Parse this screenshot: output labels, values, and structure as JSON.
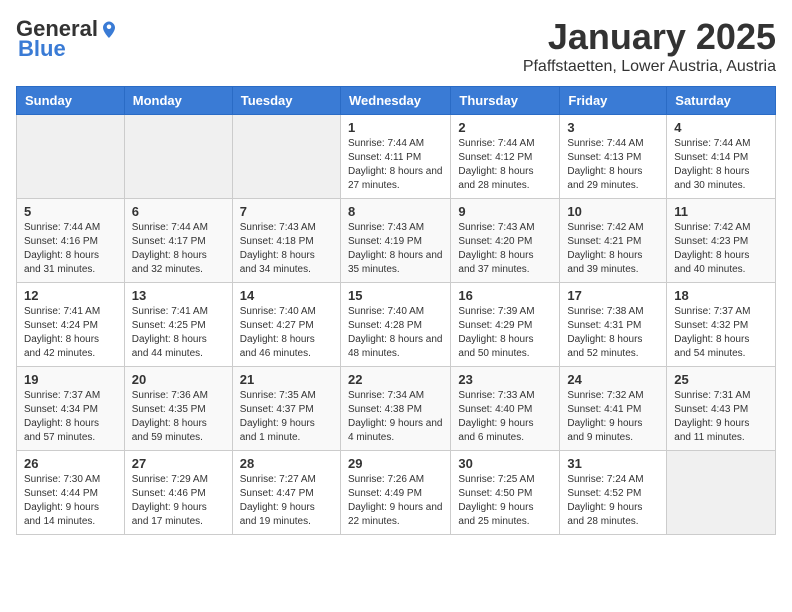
{
  "logo": {
    "general": "General",
    "blue": "Blue"
  },
  "header": {
    "month": "January 2025",
    "location": "Pfaffstaetten, Lower Austria, Austria"
  },
  "weekdays": [
    "Sunday",
    "Monday",
    "Tuesday",
    "Wednesday",
    "Thursday",
    "Friday",
    "Saturday"
  ],
  "weeks": [
    [
      {
        "day": "",
        "info": ""
      },
      {
        "day": "",
        "info": ""
      },
      {
        "day": "",
        "info": ""
      },
      {
        "day": "1",
        "info": "Sunrise: 7:44 AM\nSunset: 4:11 PM\nDaylight: 8 hours and 27 minutes."
      },
      {
        "day": "2",
        "info": "Sunrise: 7:44 AM\nSunset: 4:12 PM\nDaylight: 8 hours and 28 minutes."
      },
      {
        "day": "3",
        "info": "Sunrise: 7:44 AM\nSunset: 4:13 PM\nDaylight: 8 hours and 29 minutes."
      },
      {
        "day": "4",
        "info": "Sunrise: 7:44 AM\nSunset: 4:14 PM\nDaylight: 8 hours and 30 minutes."
      }
    ],
    [
      {
        "day": "5",
        "info": "Sunrise: 7:44 AM\nSunset: 4:16 PM\nDaylight: 8 hours and 31 minutes."
      },
      {
        "day": "6",
        "info": "Sunrise: 7:44 AM\nSunset: 4:17 PM\nDaylight: 8 hours and 32 minutes."
      },
      {
        "day": "7",
        "info": "Sunrise: 7:43 AM\nSunset: 4:18 PM\nDaylight: 8 hours and 34 minutes."
      },
      {
        "day": "8",
        "info": "Sunrise: 7:43 AM\nSunset: 4:19 PM\nDaylight: 8 hours and 35 minutes."
      },
      {
        "day": "9",
        "info": "Sunrise: 7:43 AM\nSunset: 4:20 PM\nDaylight: 8 hours and 37 minutes."
      },
      {
        "day": "10",
        "info": "Sunrise: 7:42 AM\nSunset: 4:21 PM\nDaylight: 8 hours and 39 minutes."
      },
      {
        "day": "11",
        "info": "Sunrise: 7:42 AM\nSunset: 4:23 PM\nDaylight: 8 hours and 40 minutes."
      }
    ],
    [
      {
        "day": "12",
        "info": "Sunrise: 7:41 AM\nSunset: 4:24 PM\nDaylight: 8 hours and 42 minutes."
      },
      {
        "day": "13",
        "info": "Sunrise: 7:41 AM\nSunset: 4:25 PM\nDaylight: 8 hours and 44 minutes."
      },
      {
        "day": "14",
        "info": "Sunrise: 7:40 AM\nSunset: 4:27 PM\nDaylight: 8 hours and 46 minutes."
      },
      {
        "day": "15",
        "info": "Sunrise: 7:40 AM\nSunset: 4:28 PM\nDaylight: 8 hours and 48 minutes."
      },
      {
        "day": "16",
        "info": "Sunrise: 7:39 AM\nSunset: 4:29 PM\nDaylight: 8 hours and 50 minutes."
      },
      {
        "day": "17",
        "info": "Sunrise: 7:38 AM\nSunset: 4:31 PM\nDaylight: 8 hours and 52 minutes."
      },
      {
        "day": "18",
        "info": "Sunrise: 7:37 AM\nSunset: 4:32 PM\nDaylight: 8 hours and 54 minutes."
      }
    ],
    [
      {
        "day": "19",
        "info": "Sunrise: 7:37 AM\nSunset: 4:34 PM\nDaylight: 8 hours and 57 minutes."
      },
      {
        "day": "20",
        "info": "Sunrise: 7:36 AM\nSunset: 4:35 PM\nDaylight: 8 hours and 59 minutes."
      },
      {
        "day": "21",
        "info": "Sunrise: 7:35 AM\nSunset: 4:37 PM\nDaylight: 9 hours and 1 minute."
      },
      {
        "day": "22",
        "info": "Sunrise: 7:34 AM\nSunset: 4:38 PM\nDaylight: 9 hours and 4 minutes."
      },
      {
        "day": "23",
        "info": "Sunrise: 7:33 AM\nSunset: 4:40 PM\nDaylight: 9 hours and 6 minutes."
      },
      {
        "day": "24",
        "info": "Sunrise: 7:32 AM\nSunset: 4:41 PM\nDaylight: 9 hours and 9 minutes."
      },
      {
        "day": "25",
        "info": "Sunrise: 7:31 AM\nSunset: 4:43 PM\nDaylight: 9 hours and 11 minutes."
      }
    ],
    [
      {
        "day": "26",
        "info": "Sunrise: 7:30 AM\nSunset: 4:44 PM\nDaylight: 9 hours and 14 minutes."
      },
      {
        "day": "27",
        "info": "Sunrise: 7:29 AM\nSunset: 4:46 PM\nDaylight: 9 hours and 17 minutes."
      },
      {
        "day": "28",
        "info": "Sunrise: 7:27 AM\nSunset: 4:47 PM\nDaylight: 9 hours and 19 minutes."
      },
      {
        "day": "29",
        "info": "Sunrise: 7:26 AM\nSunset: 4:49 PM\nDaylight: 9 hours and 22 minutes."
      },
      {
        "day": "30",
        "info": "Sunrise: 7:25 AM\nSunset: 4:50 PM\nDaylight: 9 hours and 25 minutes."
      },
      {
        "day": "31",
        "info": "Sunrise: 7:24 AM\nSunset: 4:52 PM\nDaylight: 9 hours and 28 minutes."
      },
      {
        "day": "",
        "info": ""
      }
    ]
  ]
}
